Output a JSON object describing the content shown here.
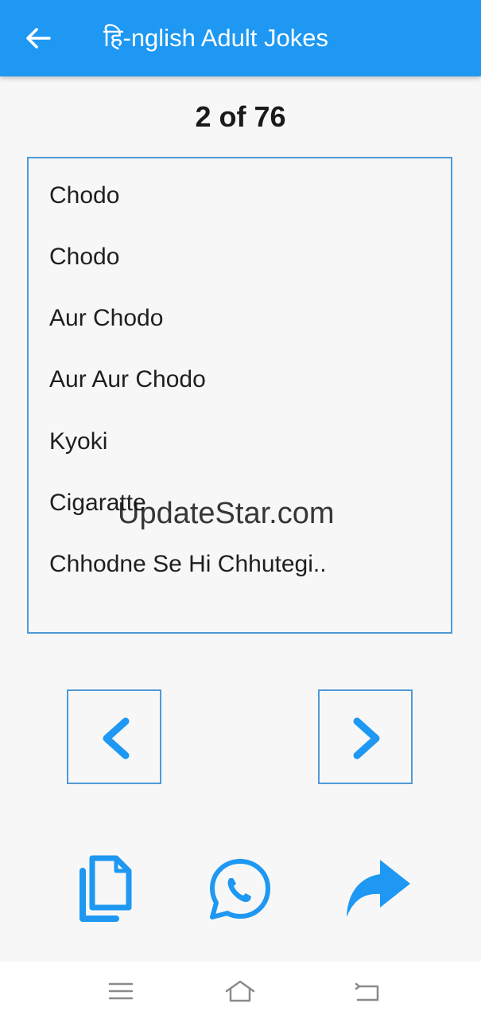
{
  "app_bar": {
    "title": "हि-nglish Adult Jokes",
    "back_icon": "arrow-left-icon",
    "color": "#1e98f2"
  },
  "counter": {
    "text": "2 of 76"
  },
  "joke": {
    "lines": [
      "Chodo",
      "Chodo",
      "Aur Chodo",
      "Aur Aur Chodo",
      "Kyoki",
      "Cigaratte",
      "Chhodne Se Hi Chhutegi.."
    ]
  },
  "watermark": {
    "text": "UpdateStar.com"
  },
  "navigation": {
    "prev_icon": "chevron-left-icon",
    "next_icon": "chevron-right-icon"
  },
  "actions": {
    "copy_icon": "copy-icon",
    "whatsapp_icon": "whatsapp-icon",
    "share_icon": "share-icon"
  },
  "system_nav": {
    "menu_icon": "menu-icon",
    "home_icon": "home-icon",
    "back_icon": "system-back-icon"
  },
  "colors": {
    "accent": "#1e98f2",
    "border": "#4e9ad9",
    "background": "#f7f7f7"
  }
}
